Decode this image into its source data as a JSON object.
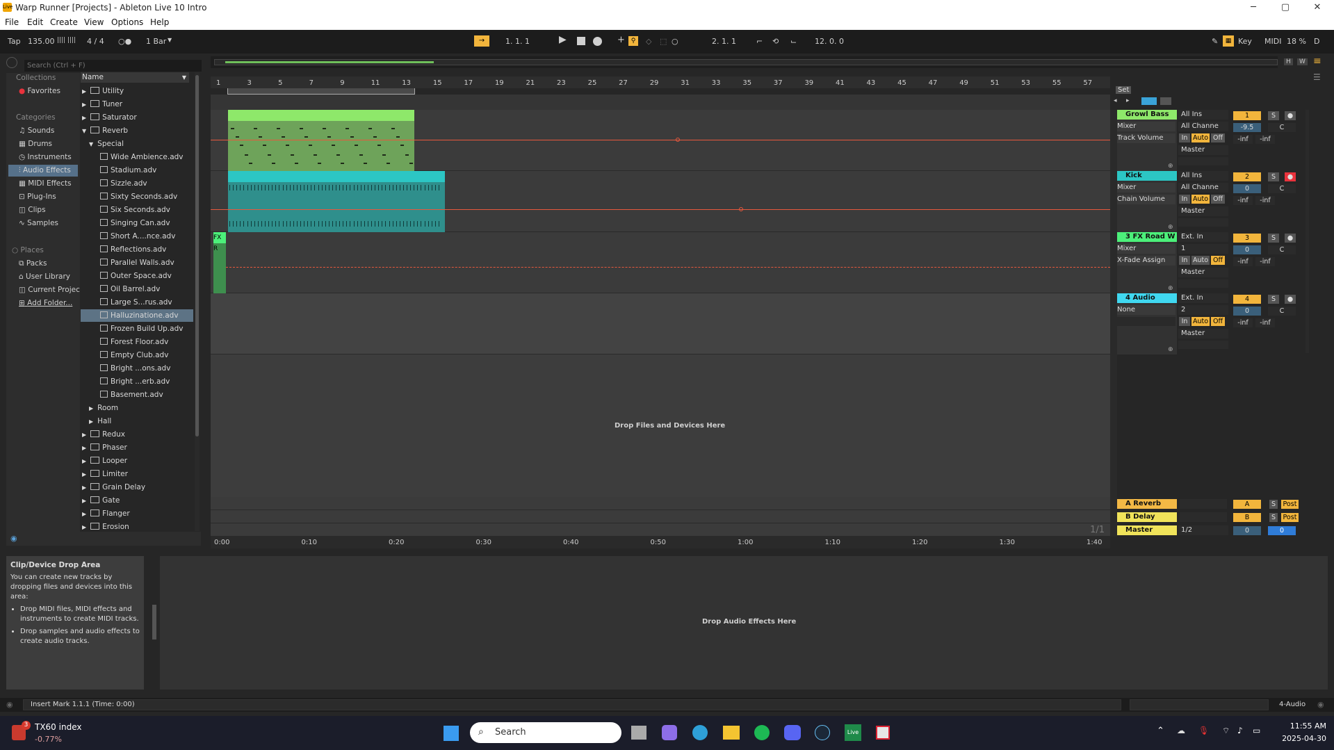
{
  "window": {
    "title": "Warp Runner  [Projects] - Ableton Live 10 Intro",
    "app_icon": "Live",
    "minimize": "─",
    "maximize": "▢",
    "close": "✕"
  },
  "menu": [
    "File",
    "Edit",
    "Create",
    "View",
    "Options",
    "Help"
  ],
  "transport": {
    "tap": "Tap",
    "tempo": "135.00",
    "meter_icon": "||||  ||||",
    "signature": "4 / 4",
    "metro": "○●",
    "quantize": "1 Bar",
    "position": "1.  1.  1",
    "loop_start": "2.  1.  1",
    "loop_length": "12.  0.  0",
    "key": "Key",
    "midi": "MIDI",
    "cpu": "18 %",
    "d": "D"
  },
  "browser": {
    "search_placeholder": "Search (Ctrl + F)",
    "collections_title": "Collections",
    "favorites": "Favorites",
    "categories_title": "Categories",
    "categories": [
      "Sounds",
      "Drums",
      "Instruments",
      "Audio Effects",
      "MIDI Effects",
      "Plug-Ins",
      "Clips",
      "Samples"
    ],
    "places_title": "Places",
    "places": [
      "Packs",
      "User Library",
      "Current Projec",
      "Add Folder..."
    ],
    "name_header": "Name",
    "items": [
      {
        "label": "Utility",
        "kind": "folder",
        "indent": 0,
        "arrow": "▶"
      },
      {
        "label": "Tuner",
        "kind": "folder",
        "indent": 0,
        "arrow": "▶"
      },
      {
        "label": "Saturator",
        "kind": "folder",
        "indent": 0,
        "arrow": "▶"
      },
      {
        "label": "Reverb",
        "kind": "folder",
        "indent": 0,
        "arrow": "▼"
      },
      {
        "label": "Special",
        "kind": "sub",
        "indent": 1,
        "arrow": "▼"
      },
      {
        "label": "Wide Ambience.adv",
        "kind": "file",
        "indent": 2,
        "arrow": ""
      },
      {
        "label": "Stadium.adv",
        "kind": "file",
        "indent": 2,
        "arrow": ""
      },
      {
        "label": "Sizzle.adv",
        "kind": "file",
        "indent": 2,
        "arrow": ""
      },
      {
        "label": "Sixty Seconds.adv",
        "kind": "file",
        "indent": 2,
        "arrow": ""
      },
      {
        "label": "Six Seconds.adv",
        "kind": "file",
        "indent": 2,
        "arrow": ""
      },
      {
        "label": "Singing Can.adv",
        "kind": "file",
        "indent": 2,
        "arrow": ""
      },
      {
        "label": "Short A....nce.adv",
        "kind": "file",
        "indent": 2,
        "arrow": ""
      },
      {
        "label": "Reflections.adv",
        "kind": "file",
        "indent": 2,
        "arrow": ""
      },
      {
        "label": "Parallel Walls.adv",
        "kind": "file",
        "indent": 2,
        "arrow": ""
      },
      {
        "label": "Outer Space.adv",
        "kind": "file",
        "indent": 2,
        "arrow": ""
      },
      {
        "label": "Oil Barrel.adv",
        "kind": "file",
        "indent": 2,
        "arrow": ""
      },
      {
        "label": "Large S...rus.adv",
        "kind": "file",
        "indent": 2,
        "arrow": ""
      },
      {
        "label": "Halluzinatione.adv",
        "kind": "file",
        "indent": 2,
        "arrow": "",
        "selected": true
      },
      {
        "label": "Frozen Build Up.adv",
        "kind": "file",
        "indent": 2,
        "arrow": ""
      },
      {
        "label": "Forest Floor.adv",
        "kind": "file",
        "indent": 2,
        "arrow": ""
      },
      {
        "label": "Empty Club.adv",
        "kind": "file",
        "indent": 2,
        "arrow": ""
      },
      {
        "label": "Bright ...ons.adv",
        "kind": "file",
        "indent": 2,
        "arrow": ""
      },
      {
        "label": "Bright ...erb.adv",
        "kind": "file",
        "indent": 2,
        "arrow": ""
      },
      {
        "label": "Basement.adv",
        "kind": "file",
        "indent": 2,
        "arrow": ""
      },
      {
        "label": "Room",
        "kind": "sub",
        "indent": 1,
        "arrow": "▶"
      },
      {
        "label": "Hall",
        "kind": "sub",
        "indent": 1,
        "arrow": "▶"
      },
      {
        "label": "Redux",
        "kind": "folder",
        "indent": 0,
        "arrow": "▶"
      },
      {
        "label": "Phaser",
        "kind": "folder",
        "indent": 0,
        "arrow": "▶"
      },
      {
        "label": "Looper",
        "kind": "folder",
        "indent": 0,
        "arrow": "▶"
      },
      {
        "label": "Limiter",
        "kind": "folder",
        "indent": 0,
        "arrow": "▶"
      },
      {
        "label": "Grain Delay",
        "kind": "folder",
        "indent": 0,
        "arrow": "▶"
      },
      {
        "label": "Gate",
        "kind": "folder",
        "indent": 0,
        "arrow": "▶"
      },
      {
        "label": "Flanger",
        "kind": "folder",
        "indent": 0,
        "arrow": "▶"
      },
      {
        "label": "Erosion",
        "kind": "folder",
        "indent": 0,
        "arrow": "▶"
      }
    ]
  },
  "ruler": {
    "bars": [
      "1",
      "3",
      "5",
      "7",
      "9",
      "11",
      "13",
      "15",
      "17",
      "19",
      "21",
      "23",
      "25",
      "27",
      "29",
      "31",
      "33",
      "35",
      "37",
      "39",
      "41",
      "43",
      "45",
      "47",
      "49",
      "51",
      "53",
      "55",
      "57"
    ],
    "times": [
      "0:00",
      "0:10",
      "0:20",
      "0:30",
      "0:40",
      "0:50",
      "1:00",
      "1:10",
      "1:20",
      "1:30",
      "1:40"
    ],
    "set": "Set",
    "page": "1/1"
  },
  "tracks": [
    {
      "name": "Growl Bass",
      "color": "#8ee86a",
      "device": "Mixer",
      "param": "Track Volume",
      "input": "All Ins",
      "channel": "All Channe",
      "output": "Master",
      "number": "1",
      "vol": "-9.5",
      "pan": "C",
      "in": "In",
      "auto": "Auto",
      "off": "Off",
      "meter_l": "-inf",
      "meter_r": "-inf",
      "solo": "S",
      "arm": "●"
    },
    {
      "name": "Kick",
      "color": "#2cc6c4",
      "device": "Mixer",
      "param": "Chain Volume",
      "input": "All Ins",
      "channel": "All Channe",
      "output": "Master",
      "number": "2",
      "vol": "0",
      "pan": "C",
      "in": "In",
      "auto": "Auto",
      "off": "Off",
      "meter_l": "-inf",
      "meter_r": "-inf",
      "solo": "S",
      "arm": "●"
    },
    {
      "name": "3 FX Road W",
      "color": "#4cf07a",
      "device": "Mixer",
      "param": "X-Fade Assign",
      "input": "Ext. In",
      "channel": "1",
      "output": "Master",
      "number": "3",
      "vol": "0",
      "pan": "C",
      "in": "In",
      "auto": "Auto",
      "off": "Off",
      "meter_l": "-inf",
      "meter_r": "-inf",
      "solo": "S",
      "arm": "●",
      "clip_label": "FX R"
    },
    {
      "name": "4 Audio",
      "color": "#40d8f0",
      "device": "None",
      "param": "",
      "input": "Ext. In",
      "channel": "2",
      "output": "Master",
      "number": "4",
      "vol": "0",
      "pan": "C",
      "in": "In",
      "auto": "Auto",
      "off": "Off",
      "meter_l": "-inf",
      "meter_r": "-inf",
      "solo": "S",
      "arm": "●"
    }
  ],
  "returns": [
    {
      "name": "A Reverb",
      "color": "#f3b845",
      "letter": "A",
      "solo": "S",
      "post": "Post"
    },
    {
      "name": "B Delay",
      "color": "#f0e35a",
      "letter": "B",
      "solo": "S",
      "post": "Post"
    }
  ],
  "master": {
    "name": "Master",
    "color": "#f0e35a",
    "cue": "1/2",
    "vol": "0",
    "pan": "0"
  },
  "drop_files": "Drop Files and Devices Here",
  "drop_audio_effects": "Drop Audio Effects Here",
  "info": {
    "title": "Clip/Device Drop Area",
    "body": "You can create new tracks by dropping files and devices into this area:",
    "bullets": [
      "Drop MIDI files, MIDI effects and instruments to create MIDI tracks.",
      "Drop samples and audio effects to create audio tracks."
    ]
  },
  "status": {
    "message": "Insert Mark 1.1.1 (Time: 0:00)",
    "track": "4-Audio"
  },
  "taskbar": {
    "ticker_name": "TX60 index",
    "ticker_change": "-0.77%",
    "badge": "3",
    "search": "Search",
    "time": "11:55 AM",
    "date": "2025-04-30"
  },
  "colors": {
    "accent": "#f2b53c",
    "automation": "#e8583d",
    "selection": "#8fb5c9"
  }
}
